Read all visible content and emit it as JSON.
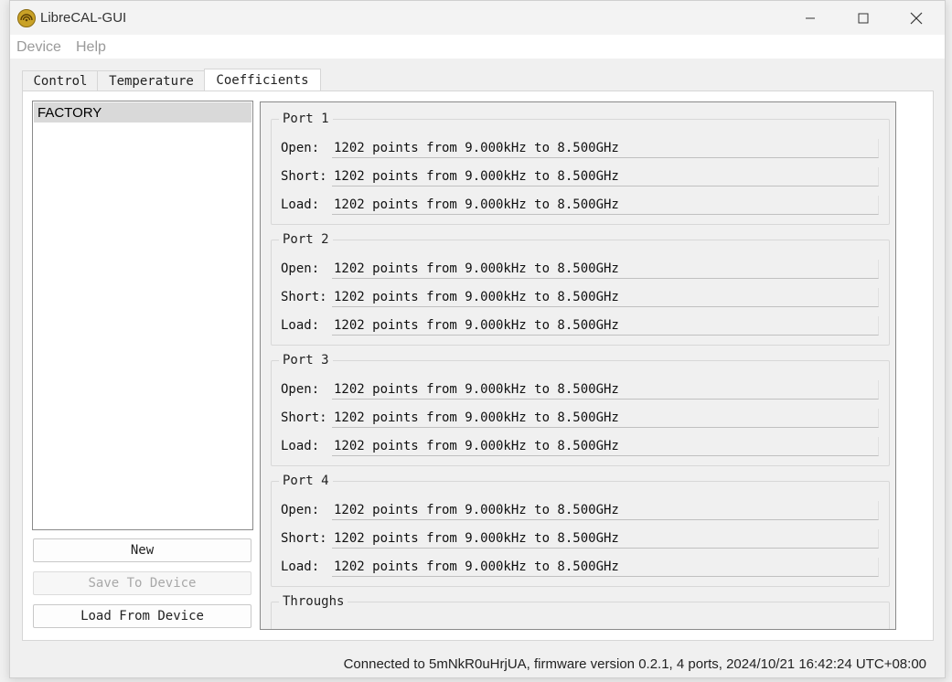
{
  "window": {
    "title": "LibreCAL-GUI"
  },
  "menu": {
    "items": [
      "Device",
      "Help"
    ]
  },
  "tabs": [
    {
      "label": "Control",
      "active": false
    },
    {
      "label": "Temperature",
      "active": false
    },
    {
      "label": "Coefficients",
      "active": true
    }
  ],
  "coeff_list": {
    "items": [
      "FACTORY"
    ],
    "selected": "FACTORY"
  },
  "buttons": {
    "new": "New",
    "save_to_device": "Save To Device",
    "load_from_device": "Load From Device"
  },
  "ports": [
    {
      "title": "Port 1",
      "rows": [
        {
          "label": "Open:",
          "value": "1202 points from 9.000kHz to 8.500GHz"
        },
        {
          "label": "Short:",
          "value": "1202 points from 9.000kHz to 8.500GHz"
        },
        {
          "label": "Load:",
          "value": "1202 points from 9.000kHz to 8.500GHz"
        }
      ]
    },
    {
      "title": "Port 2",
      "rows": [
        {
          "label": "Open:",
          "value": "1202 points from 9.000kHz to 8.500GHz"
        },
        {
          "label": "Short:",
          "value": "1202 points from 9.000kHz to 8.500GHz"
        },
        {
          "label": "Load:",
          "value": "1202 points from 9.000kHz to 8.500GHz"
        }
      ]
    },
    {
      "title": "Port 3",
      "rows": [
        {
          "label": "Open:",
          "value": "1202 points from 9.000kHz to 8.500GHz"
        },
        {
          "label": "Short:",
          "value": "1202 points from 9.000kHz to 8.500GHz"
        },
        {
          "label": "Load:",
          "value": "1202 points from 9.000kHz to 8.500GHz"
        }
      ]
    },
    {
      "title": "Port 4",
      "rows": [
        {
          "label": "Open:",
          "value": "1202 points from 9.000kHz to 8.500GHz"
        },
        {
          "label": "Short:",
          "value": "1202 points from 9.000kHz to 8.500GHz"
        },
        {
          "label": "Load:",
          "value": "1202 points from 9.000kHz to 8.500GHz"
        }
      ]
    }
  ],
  "throughs": {
    "title": "Throughs"
  },
  "status": {
    "text": "Connected to 5mNkR0uHrjUA, firmware version 0.2.1, 4 ports, 2024/10/21 16:42:24 UTC+08:00"
  },
  "icons": {
    "app": "librecal-logo-icon",
    "minimize": "minimize-icon",
    "maximize": "maximize-icon",
    "close": "close-icon"
  },
  "colors": {
    "selection": "#d9d9d9",
    "disabled_text": "#a8a8a8",
    "menu_text": "#9a9a9a"
  }
}
